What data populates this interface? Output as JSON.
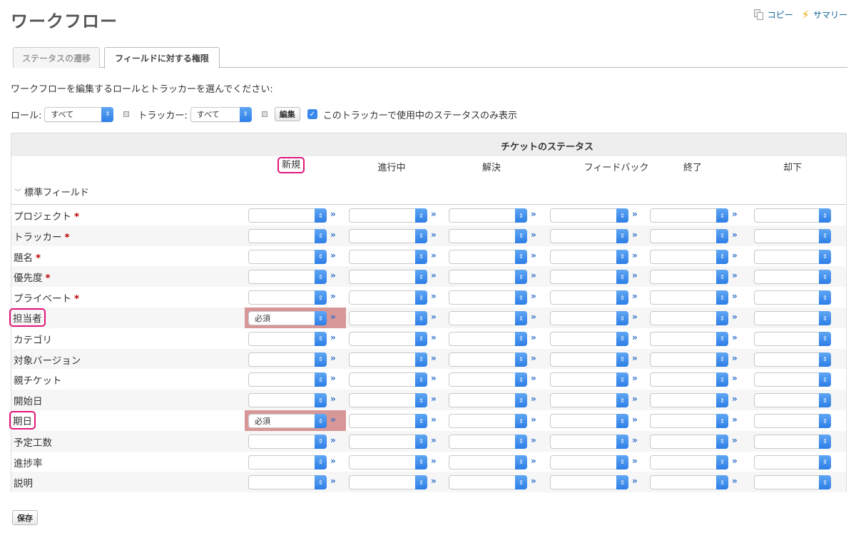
{
  "page": {
    "title": "ワークフロー"
  },
  "context_menu": {
    "copy_label": "コピー",
    "summary_label": "サマリー"
  },
  "tabs": [
    {
      "label": "ステータスの遷移",
      "active": false
    },
    {
      "label": "フィールドに対する権限",
      "active": true
    }
  ],
  "instruction": "ワークフローを編集するロールとトラッカーを選んでください:",
  "filters": {
    "role_label": "ロール:",
    "role_value": "すべて",
    "tracker_label": "トラッカー:",
    "tracker_value": "すべて",
    "edit_label": "編集",
    "only_used_statuses_label": "このトラッカーで使用中のステータスのみ表示",
    "only_used_statuses_checked": true
  },
  "table": {
    "status_header": "チケットのステータス",
    "statuses": [
      "新規",
      "進行中",
      "解決",
      "フィードバック",
      "終了",
      "却下"
    ],
    "section_label": "標準フィールド",
    "fields": [
      {
        "name": "プロジェクト",
        "required": true,
        "values": [
          "",
          "",
          "",
          "",
          "",
          ""
        ]
      },
      {
        "name": "トラッカー",
        "required": true,
        "values": [
          "",
          "",
          "",
          "",
          "",
          ""
        ]
      },
      {
        "name": "題名",
        "required": true,
        "values": [
          "",
          "",
          "",
          "",
          "",
          ""
        ]
      },
      {
        "name": "優先度",
        "required": true,
        "values": [
          "",
          "",
          "",
          "",
          "",
          ""
        ]
      },
      {
        "name": "プライベート",
        "required": true,
        "values": [
          "",
          "",
          "",
          "",
          "",
          ""
        ]
      },
      {
        "name": "担当者",
        "required": false,
        "values": [
          "必須",
          "",
          "",
          "",
          "",
          ""
        ]
      },
      {
        "name": "カテゴリ",
        "required": false,
        "values": [
          "",
          "",
          "",
          "",
          "",
          ""
        ]
      },
      {
        "name": "対象バージョン",
        "required": false,
        "values": [
          "",
          "",
          "",
          "",
          "",
          ""
        ]
      },
      {
        "name": "親チケット",
        "required": false,
        "values": [
          "",
          "",
          "",
          "",
          "",
          ""
        ]
      },
      {
        "name": "開始日",
        "required": false,
        "values": [
          "",
          "",
          "",
          "",
          "",
          ""
        ]
      },
      {
        "name": "期日",
        "required": false,
        "values": [
          "必須",
          "",
          "",
          "",
          "",
          ""
        ]
      },
      {
        "name": "予定工数",
        "required": false,
        "values": [
          "",
          "",
          "",
          "",
          "",
          ""
        ]
      },
      {
        "name": "進捗率",
        "required": false,
        "values": [
          "",
          "",
          "",
          "",
          "",
          ""
        ]
      },
      {
        "name": "説明",
        "required": false,
        "values": [
          "",
          "",
          "",
          "",
          "",
          ""
        ]
      }
    ],
    "required_mark": "*",
    "copy_right_glyph": "»"
  },
  "save_label": "保存",
  "colors": {
    "highlight": "#e2157a",
    "required_cell": "#d79796",
    "select_accent": "#2d7ee6"
  }
}
